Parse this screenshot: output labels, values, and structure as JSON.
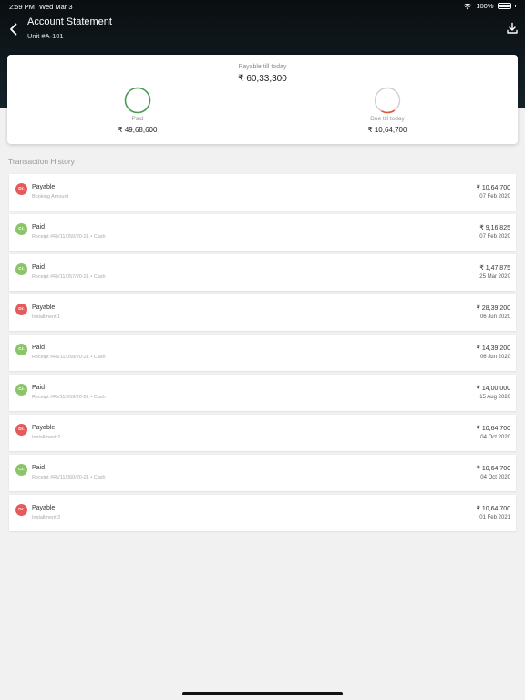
{
  "status_bar": {
    "time": "2:59 PM",
    "date": "Wed Mar 3",
    "battery": "100%"
  },
  "header": {
    "title": "Account Statement",
    "subtitle": "Unit #A-101"
  },
  "summary": {
    "payable_label": "Payable till today",
    "payable_value": "₹ 60,33,300",
    "paid_label": "Paid",
    "paid_value": "₹ 49,68,600",
    "due_label": "Due till today",
    "due_value": "₹ 10,64,700",
    "paid_fraction": 0.8235,
    "due_fraction": 0.1765,
    "paid_color": "#4a9a55",
    "due_color": "#e05a3a"
  },
  "history_title": "Transaction History",
  "transactions": [
    {
      "badge": "Dr.",
      "kind": "dr",
      "type": "Payable",
      "desc": "Booking Amount",
      "amount": "₹ 10,64,700",
      "date": "07 Feb 2020"
    },
    {
      "badge": "Cr.",
      "kind": "cr",
      "type": "Paid",
      "desc": "Receipt #RV11/050/20-21 • Cash",
      "amount": "₹ 9,16,825",
      "date": "07 Feb 2020"
    },
    {
      "badge": "Cr.",
      "kind": "cr",
      "type": "Paid",
      "desc": "Receipt #RV11/057/20-21 • Cash",
      "amount": "₹ 1,47,875",
      "date": "25 Mar 2020"
    },
    {
      "badge": "Dr.",
      "kind": "dr",
      "type": "Payable",
      "desc": "Installment 1",
      "amount": "₹ 28,39,200",
      "date": "06 Jun 2020"
    },
    {
      "badge": "Cr.",
      "kind": "cr",
      "type": "Paid",
      "desc": "Receipt #RV11/058/20-21 • Cash",
      "amount": "₹ 14,39,200",
      "date": "06 Jun 2020"
    },
    {
      "badge": "Cr.",
      "kind": "cr",
      "type": "Paid",
      "desc": "Receipt #RV11/059/20-21 • Cash",
      "amount": "₹ 14,00,000",
      "date": "15 Aug 2020"
    },
    {
      "badge": "Dr.",
      "kind": "dr",
      "type": "Payable",
      "desc": "Installment 2",
      "amount": "₹ 10,64,700",
      "date": "04 Oct 2020"
    },
    {
      "badge": "Cr.",
      "kind": "cr",
      "type": "Paid",
      "desc": "Receipt #RV11/060/20-21 • Cash",
      "amount": "₹ 10,64,700",
      "date": "04 Oct 2020"
    },
    {
      "badge": "Dr.",
      "kind": "dr",
      "type": "Payable",
      "desc": "Installment 3",
      "amount": "₹ 10,64,700",
      "date": "01 Feb 2021"
    }
  ],
  "colors": {
    "header_bg": "#0f1a20",
    "debit": "#e55a5a",
    "credit": "#8cc46a"
  }
}
